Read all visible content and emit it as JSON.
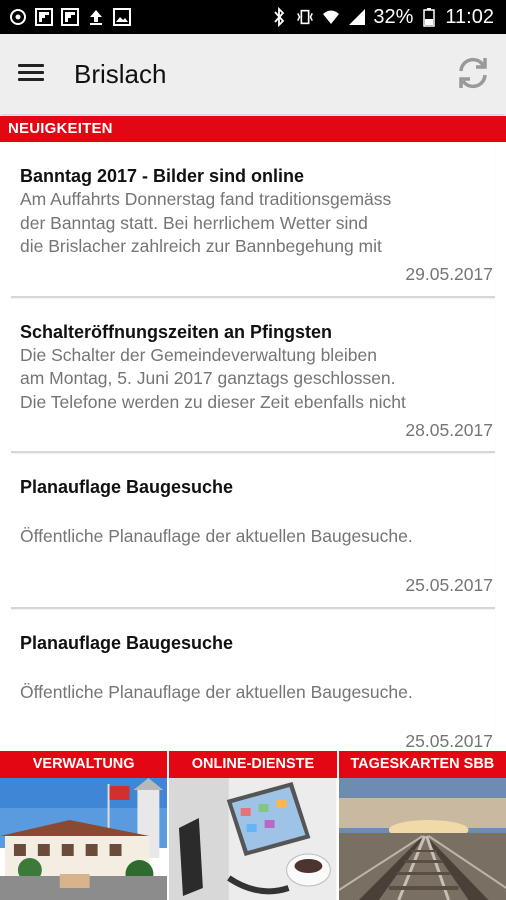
{
  "status_bar": {
    "battery_percent": "32%",
    "time": "11:02",
    "left_icons": [
      "settings-icon",
      "flipboard-icon",
      "flipboard-icon",
      "upload-icon",
      "image-icon"
    ],
    "right_icons": [
      "bluetooth-icon",
      "vibrate-icon",
      "wifi-icon",
      "signal-icon",
      "battery-icon"
    ]
  },
  "app_bar": {
    "title": "Brislach",
    "menu_icon": "menu-icon",
    "refresh_icon": "refresh-icon"
  },
  "section": {
    "title": "NEUIGKEITEN"
  },
  "news": [
    {
      "title": "Banntag 2017 - Bilder sind online",
      "lines": [
        "Am Auffahrts Donnerstag fand traditionsgemäss",
        "der Banntag statt. Bei herrlichem Wetter sind",
        "die Brislacher zahlreich zur Bannbegehung mit"
      ],
      "date": "29.05.2017"
    },
    {
      "title": "Schalteröffnungszeiten an Pfingsten",
      "lines": [
        "Die Schalter der Gemeindeverwaltung bleiben",
        "am  Montag, 5. Juni 2017  ganztags geschlossen.",
        "Die Telefone werden zu dieser Zeit ebenfalls nicht"
      ],
      "date": "28.05.2017"
    },
    {
      "title": "Planauflage Baugesuche",
      "lines": [
        "Öffentliche Planauflage der aktuellen Baugesuche."
      ],
      "date": "25.05.2017"
    },
    {
      "title": "Planauflage Baugesuche",
      "lines": [
        "Öffentliche Planauflage der aktuellen Baugesuche."
      ],
      "date": "25.05.2017"
    }
  ],
  "tiles": [
    {
      "label": "VERWALTUNG"
    },
    {
      "label": "ONLINE-DIENSTE"
    },
    {
      "label": "TAGESKARTEN SBB"
    }
  ],
  "colors": {
    "accent": "#e30613",
    "appbar_bg": "#eeeeee",
    "text_secondary": "#757575"
  }
}
